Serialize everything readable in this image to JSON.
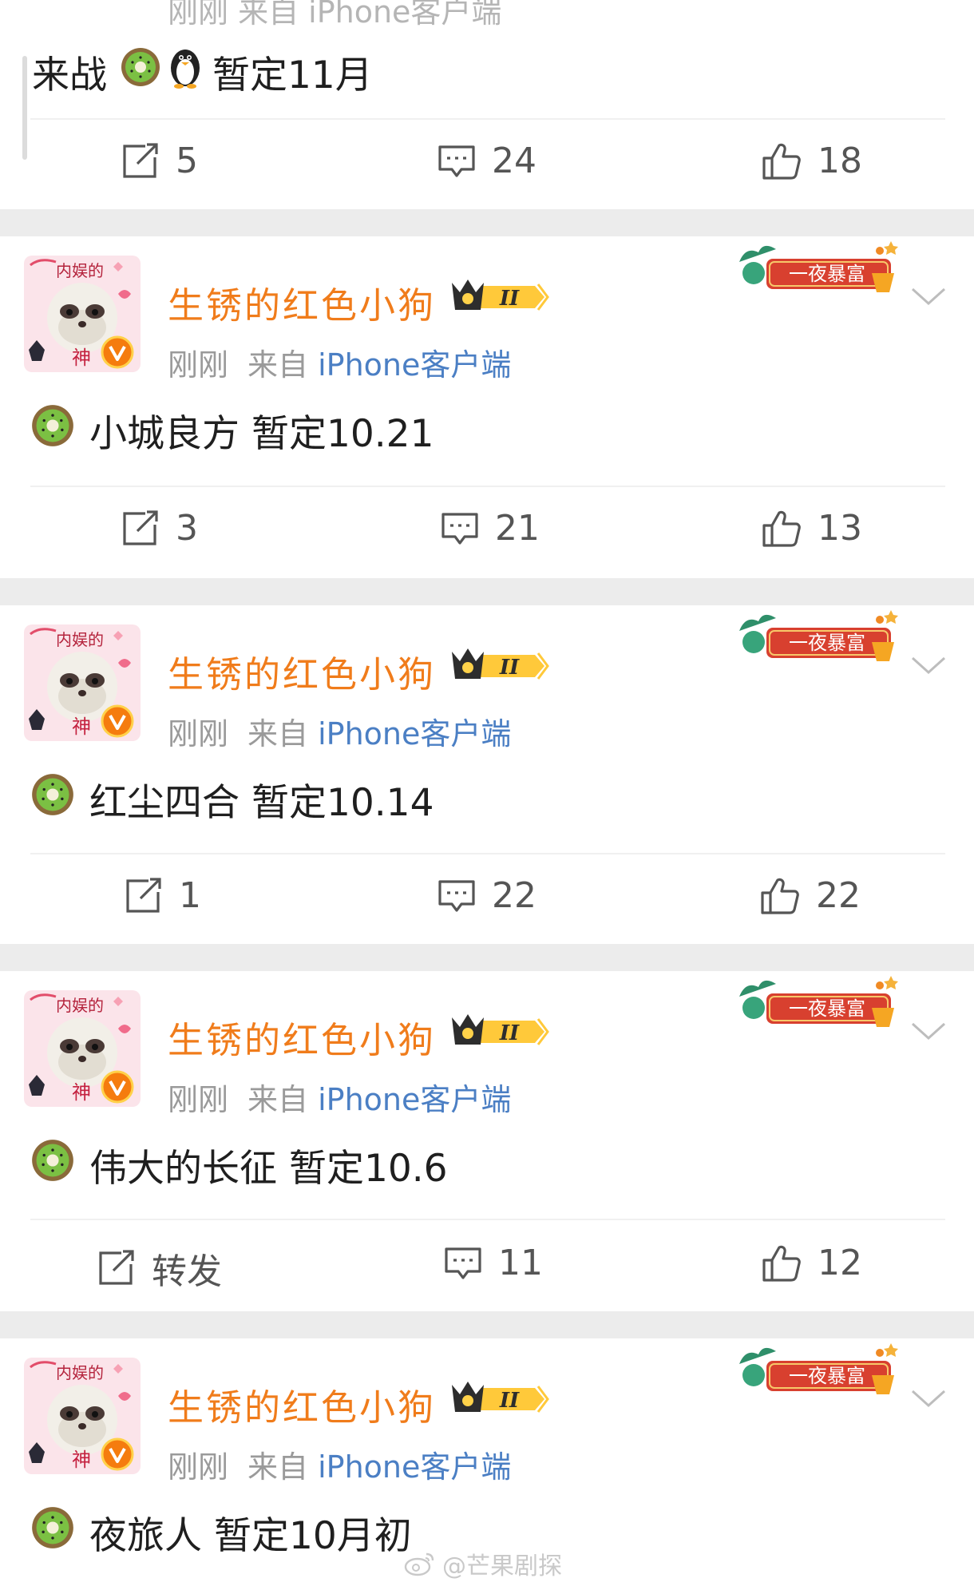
{
  "first_post": {
    "meta_partial": "刚刚  来自 iPhone客户端",
    "content_text": "来战",
    "content_text_2": "暂定11月",
    "actions": {
      "repost": "5",
      "comment": "24",
      "like": "18"
    }
  },
  "posts": [
    {
      "username": "生锈的红色小狗",
      "badge_level": "II",
      "time": "刚刚",
      "source_prefix": "来自",
      "client": "iPhone客户端",
      "event_badge": "一夜暴富",
      "avatar_text_top": "内娱的",
      "avatar_text_bottom": "神",
      "content_text": "小城良方 暂定10.21",
      "actions": {
        "repost": "3",
        "comment": "21",
        "like": "13"
      }
    },
    {
      "username": "生锈的红色小狗",
      "badge_level": "II",
      "time": "刚刚",
      "source_prefix": "来自",
      "client": "iPhone客户端",
      "event_badge": "一夜暴富",
      "avatar_text_top": "内娱的",
      "avatar_text_bottom": "神",
      "content_text": "红尘四合 暂定10.14",
      "actions": {
        "repost": "1",
        "comment": "22",
        "like": "22"
      }
    },
    {
      "username": "生锈的红色小狗",
      "badge_level": "II",
      "time": "刚刚",
      "source_prefix": "来自",
      "client": "iPhone客户端",
      "event_badge": "一夜暴富",
      "avatar_text_top": "内娱的",
      "avatar_text_bottom": "神",
      "content_text": "伟大的长征 暂定10.6",
      "actions": {
        "repost": "转发",
        "comment": "11",
        "like": "12"
      }
    },
    {
      "username": "生锈的红色小狗",
      "badge_level": "II",
      "time": "刚刚",
      "source_prefix": "来自",
      "client": "iPhone客户端",
      "event_badge": "一夜暴富",
      "avatar_text_top": "内娱的",
      "avatar_text_bottom": "神",
      "content_text": "夜旅人 暂定10月初"
    }
  ],
  "watermark": "@芒果剧探",
  "colors": {
    "username": "#f07c1b",
    "client": "#4b7fc4",
    "meta": "#9a9a9a",
    "action": "#555555",
    "gap": "#ececec"
  },
  "icons": [
    "repost-icon",
    "comment-icon",
    "like-icon",
    "kiwi-emoji",
    "penguin-emoji",
    "crown-badge-icon",
    "chevron-down-icon",
    "weibo-logo-icon"
  ]
}
